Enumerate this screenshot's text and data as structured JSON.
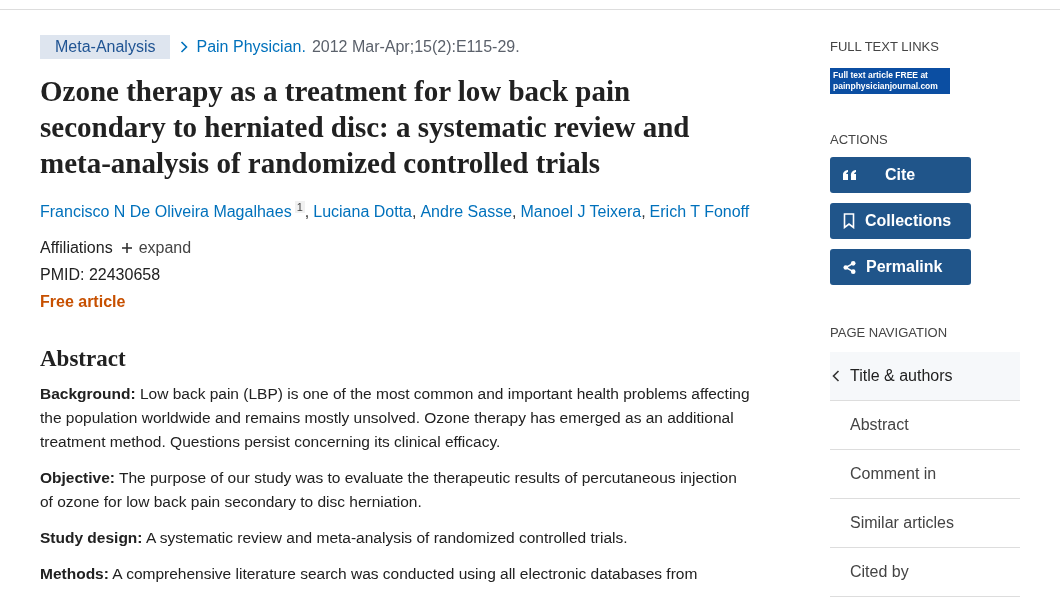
{
  "article_type": "Meta-Analysis",
  "citation": {
    "journal": "Pain Physician.",
    "details": "2012 Mar-Apr;15(2):E115-29."
  },
  "title": "Ozone therapy as a treatment for low back pain secondary to herniated disc: a systematic review and meta-analysis of randomized controlled trials",
  "authors": [
    {
      "name": "Francisco N De Oliveira Magalhaes",
      "affiliation": "1",
      "separator": ","
    },
    {
      "name": "Luciana Dotta",
      "separator": ","
    },
    {
      "name": "Andre Sasse",
      "separator": ","
    },
    {
      "name": "Manoel J Teixera",
      "separator": ","
    },
    {
      "name": "Erich T Fonoff"
    }
  ],
  "affiliations": {
    "label": "Affiliations",
    "toggle": "expand",
    "expanded": false
  },
  "pmid": "PMID: 22430658",
  "free_label": "Free article",
  "abstract": {
    "heading": "Abstract",
    "paragraphs": [
      {
        "label": "Background:",
        "text": "Low back pain (LBP) is one of the most common and important health problems affecting the population worldwide and remains mostly unsolved. Ozone therapy has emerged as an additional treatment method. Questions persist concerning its clinical efficacy."
      },
      {
        "label": "Objective:",
        "text": "The purpose of our study was to evaluate the therapeutic results of percutaneous injection of ozone for low back pain secondary to disc herniation."
      },
      {
        "label": "Study design:",
        "text": "A systematic review and meta-analysis of randomized controlled trials."
      },
      {
        "label": "Methods:",
        "text": "A comprehensive literature search was conducted using all electronic databases from"
      }
    ]
  },
  "sidebar": {
    "full_text_heading": "FULL TEXT LINKS",
    "full_text_link": "Full text article **FREE** at painphysicianjournal.com",
    "actions_heading": "ACTIONS",
    "actions": [
      {
        "kind": "cite",
        "label": "Cite"
      },
      {
        "kind": "collections",
        "label": "Collections"
      },
      {
        "kind": "permalink",
        "label": "Permalink"
      }
    ],
    "nav_heading": "PAGE NAVIGATION",
    "nav": [
      {
        "label": "Title & authors",
        "selected": true
      },
      {
        "label": "Abstract",
        "selected": false
      },
      {
        "label": "Comment in",
        "selected": false
      },
      {
        "label": "Similar articles",
        "selected": false
      },
      {
        "label": "Cited by",
        "selected": false
      }
    ]
  }
}
